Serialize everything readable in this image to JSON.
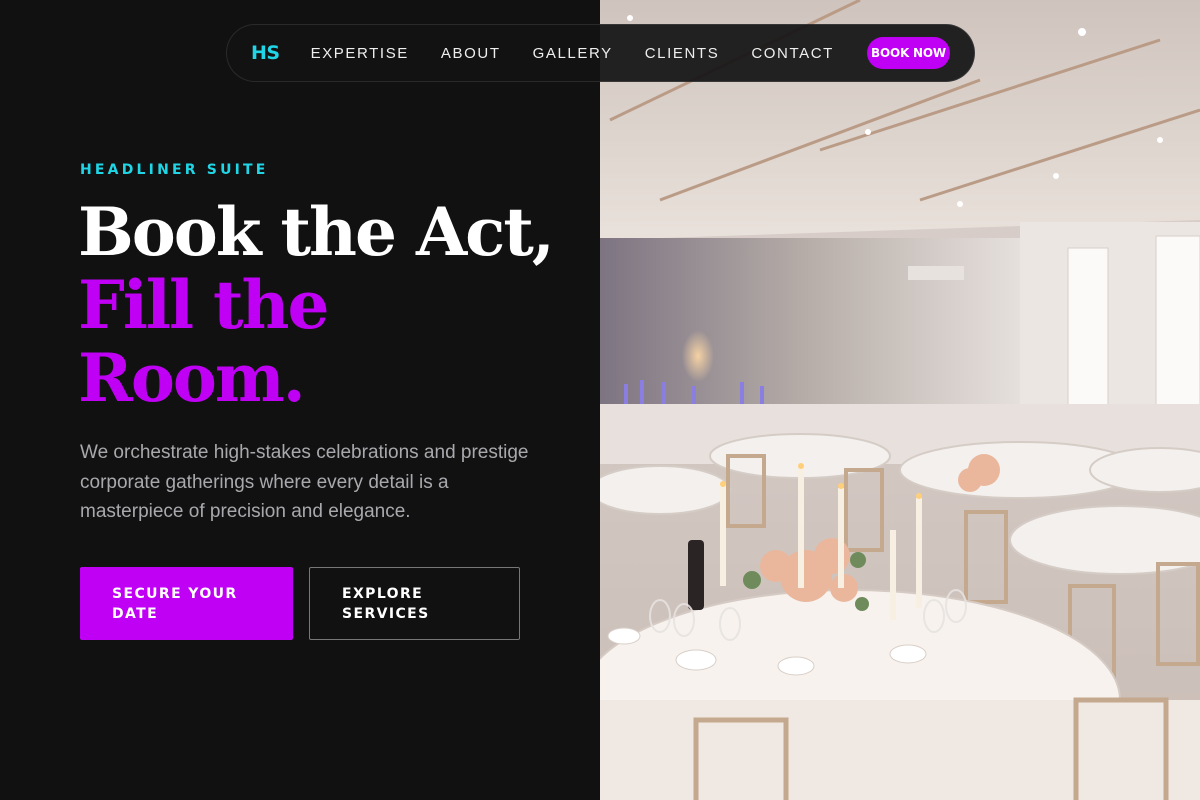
{
  "brand": {
    "logo_text": "HS",
    "accent_cyan": "#20d6e6",
    "accent_magenta": "#c000f5",
    "background": "#111112"
  },
  "nav": {
    "links": [
      "EXPERTISE",
      "ABOUT",
      "GALLERY",
      "CLIENTS",
      "CONTACT"
    ],
    "cta_label": "BOOK NOW"
  },
  "hero": {
    "eyebrow": "HEADLINER SUITE",
    "headline_line1": "Book the Act,",
    "headline_line2": "Fill the",
    "headline_line3": "Room.",
    "description": "We orchestrate high-stakes celebrations and prestige corporate gatherings where every detail is a masterpiece of precision and elegance.",
    "primary_cta_line1": "SECURE YOUR",
    "primary_cta_line2": "DATE",
    "secondary_cta_line1": "EXPLORE",
    "secondary_cta_line2": "SERVICES"
  },
  "photo": {
    "subject": "banquet-hall-image"
  }
}
